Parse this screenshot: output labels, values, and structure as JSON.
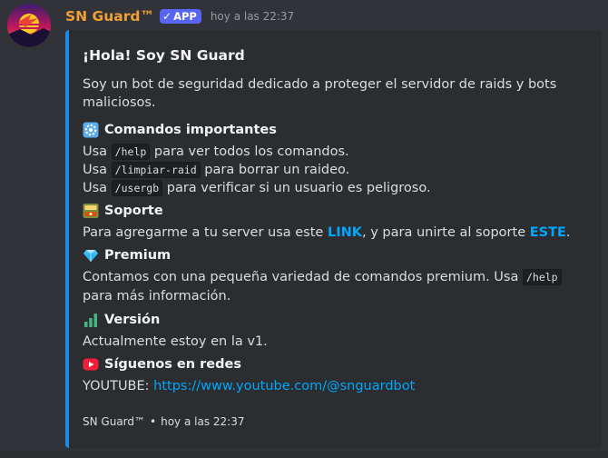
{
  "message": {
    "author": "SN Guard™",
    "badge": "APP",
    "timestamp": "hoy a las 22:37"
  },
  "embed": {
    "accent_color": "#1e88e5",
    "title": "¡Hola! Soy SN Guard",
    "intro": "Soy un bot de seguridad dedicado a proteger el servidor de raids y bots maliciosos.",
    "sections": {
      "commands": {
        "icon": "gear-emoji",
        "title": "Comandos importantes",
        "lines": [
          {
            "pre": "Usa ",
            "code": "/help",
            "post": " para ver todos los comandos."
          },
          {
            "pre": "Usa ",
            "code": "/limpiar-raid",
            "post": " para borrar un raideo."
          },
          {
            "pre": "Usa ",
            "code": "/usergb",
            "post": " para verificar si un usuario es peligroso."
          }
        ]
      },
      "support": {
        "icon": "ticket-emoji",
        "title": "Soporte",
        "pre": "Para agregarme a tu server usa este ",
        "link1": "LINK",
        "mid": ", y para unirte al soporte ",
        "link2": "ESTE",
        "post": "."
      },
      "premium": {
        "icon": "gem-emoji",
        "title": "Premium",
        "pre": "Contamos con una pequeña variedad de comandos premium. Usa ",
        "code": "/help",
        "post": " para más información."
      },
      "version": {
        "icon": "bar-chart-emoji",
        "title": "Versión",
        "text": "Actualmente estoy en la v1."
      },
      "social": {
        "icon": "youtube-emoji",
        "title": "Síguenos en redes",
        "label": "YOUTUBE: ",
        "url": "https://www.youtube.com/@snguardbot"
      }
    },
    "footer": {
      "author": "SN Guard™",
      "separator": "•",
      "timestamp": "hoy a las 22:37"
    }
  }
}
